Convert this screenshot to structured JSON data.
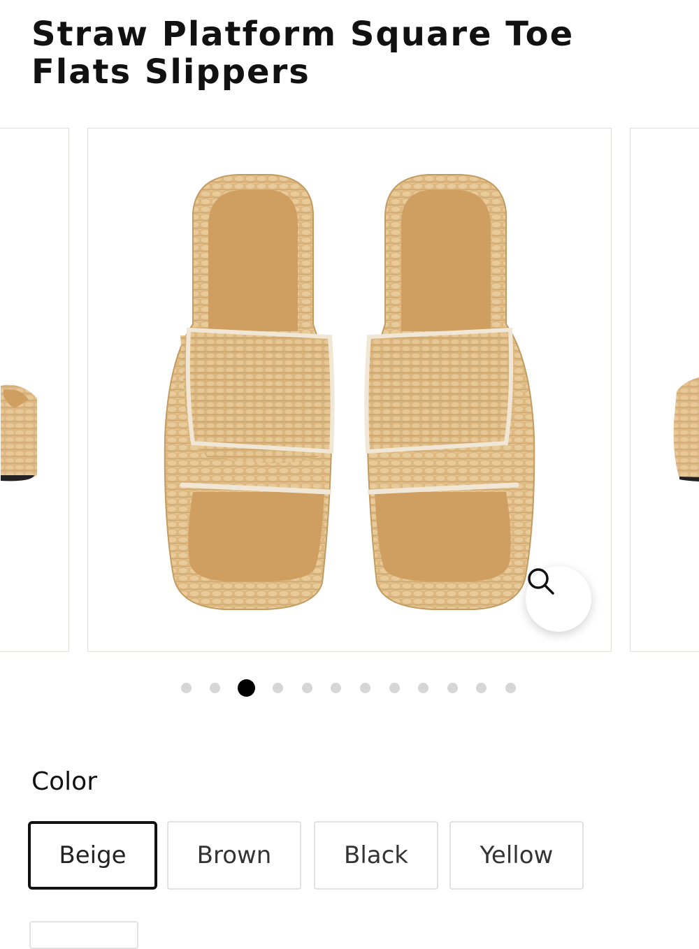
{
  "product": {
    "title": "Straw Platform Square Toe Flats Slippers"
  },
  "gallery": {
    "slide_count": 12,
    "active_index": 2,
    "zoom_icon": "search-icon",
    "colors": {
      "straw": "#DDB884",
      "insole": "#CF9F62",
      "trim": "#F1E7D6"
    }
  },
  "options": {
    "color_label": "Color",
    "selected": "Beige",
    "colors": [
      "Beige",
      "Brown",
      "Black",
      "Yellow"
    ]
  }
}
